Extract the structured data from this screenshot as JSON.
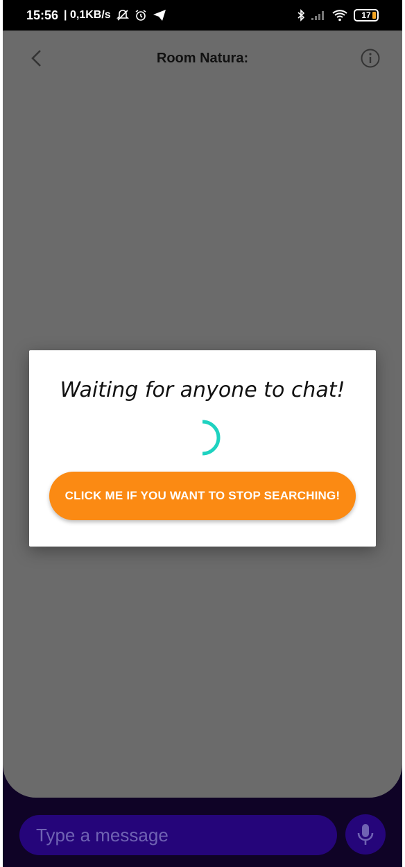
{
  "status_bar": {
    "time": "15:56",
    "speed": "| 0,1KB/s",
    "battery_level": "17",
    "icons": [
      "bell-off-icon",
      "alarm-icon",
      "telegram-icon",
      "bluetooth-icon",
      "signal-icon",
      "wifi-icon",
      "battery-icon"
    ]
  },
  "header": {
    "title": "Room Natura:",
    "back_icon": "chevron-left-icon",
    "info_icon": "info-icon"
  },
  "dialog": {
    "title": "Waiting for anyone to chat!",
    "button_label": "CLICK ME IF YOU WANT TO STOP SEARCHING!",
    "spinner_color": "#1ed2c0",
    "button_color": "#fb8a13"
  },
  "composer": {
    "placeholder": "Type a message",
    "mic_icon": "microphone-icon"
  },
  "colors": {
    "overlay": "#6b6b6b",
    "background": "#0f0326",
    "input_bg": "#25057a"
  }
}
